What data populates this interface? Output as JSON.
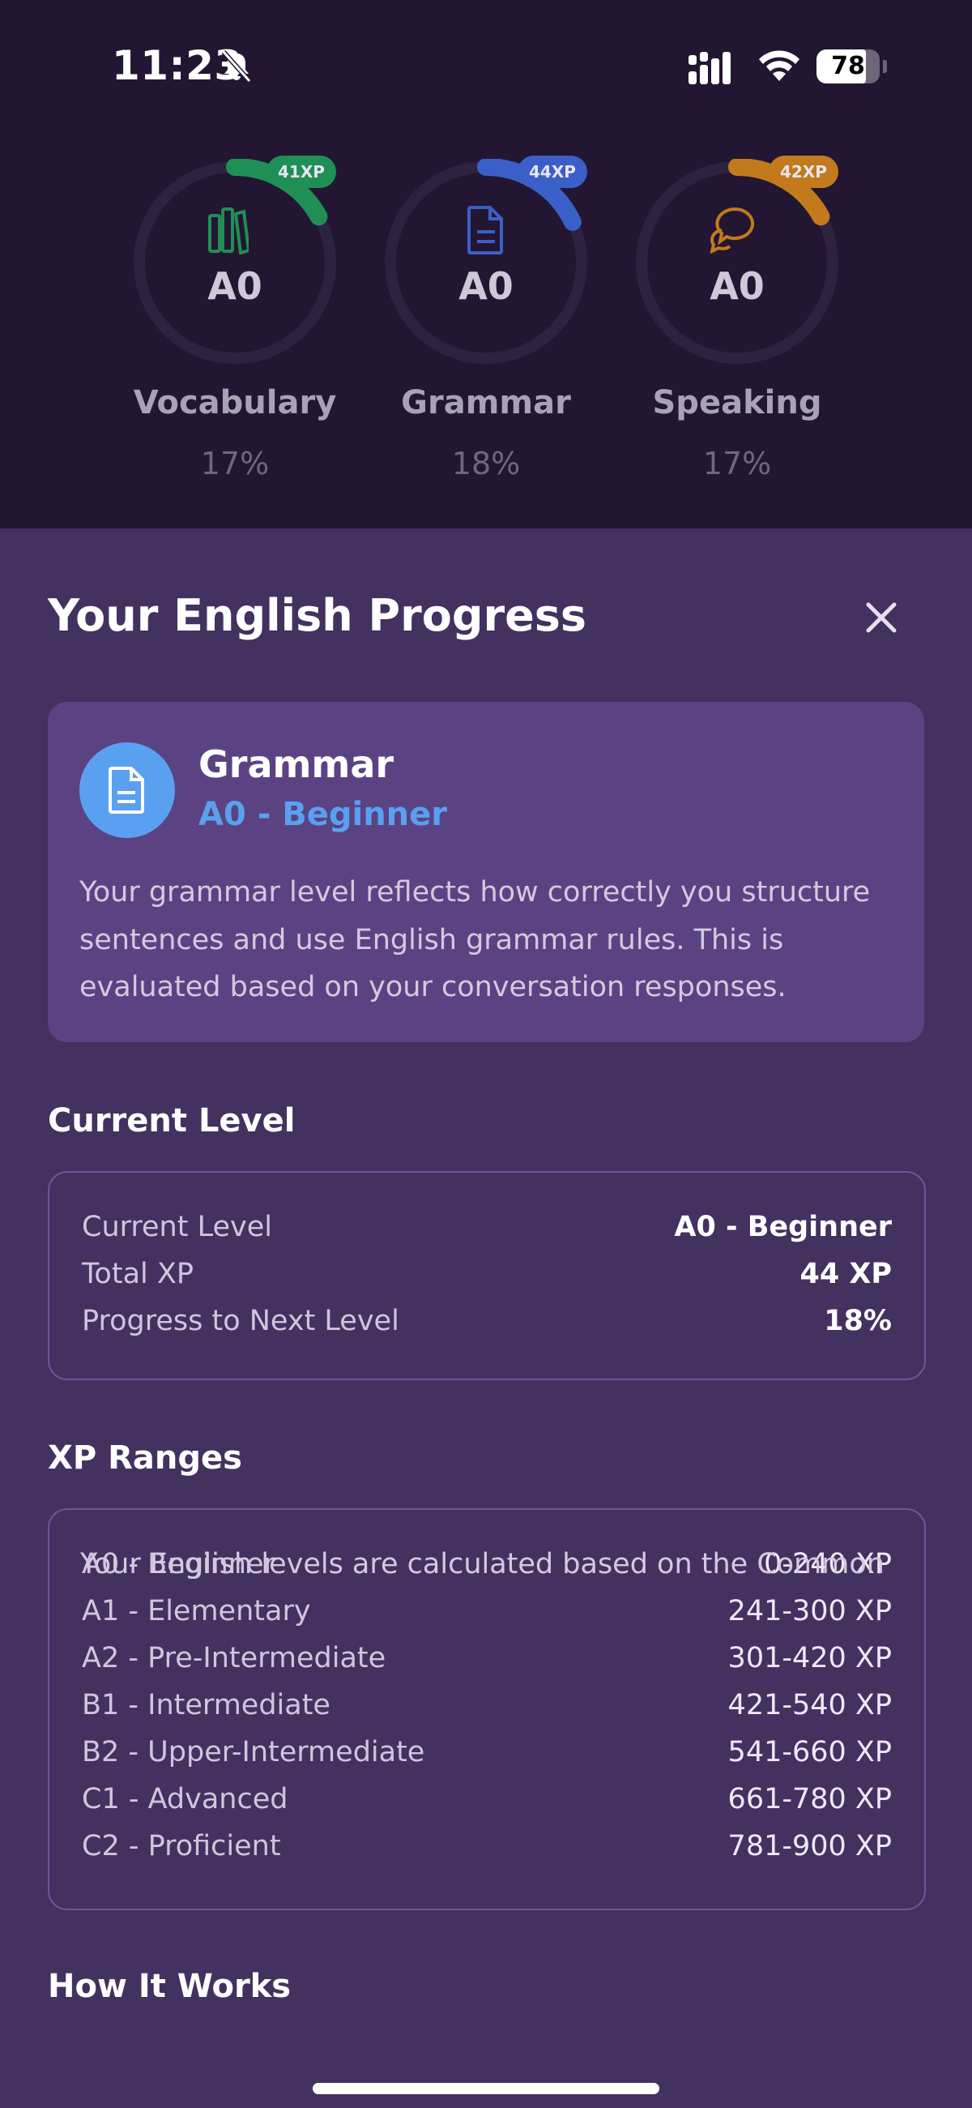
{
  "status_bar": {
    "time": "11:23",
    "battery": "78",
    "battery_level": 0.78
  },
  "skills": [
    {
      "name": "Vocabulary",
      "level": "A0",
      "percent": "17%",
      "progress": 0.17,
      "xp": "41XP",
      "color": "#1f8f55",
      "icon": "books-icon"
    },
    {
      "name": "Grammar",
      "level": "A0",
      "percent": "18%",
      "progress": 0.18,
      "xp": "44XP",
      "color": "#3b5fc8",
      "icon": "document-icon"
    },
    {
      "name": "Speaking",
      "level": "A0",
      "percent": "17%",
      "progress": 0.17,
      "xp": "42XP",
      "color": "#c27a1c",
      "icon": "chat-bubbles-icon"
    }
  ],
  "sheet": {
    "title": "Your English Progress",
    "info": {
      "title": "Grammar",
      "subtitle": "A0 - Beginner",
      "description": "Your grammar level reflects how correctly you structure sentences and use English grammar rules. This is evaluated based on your conversation responses."
    },
    "current_level": {
      "heading": "Current Level",
      "rows": [
        {
          "label": "Current Level",
          "value": "A0 - Beginner"
        },
        {
          "label": "Total XP",
          "value": "44 XP"
        },
        {
          "label": "Progress to Next Level",
          "value": "18%"
        }
      ]
    },
    "xp_ranges": {
      "heading": "XP Ranges",
      "rows": [
        {
          "label": "A0 - Beginner",
          "value": "0-240 XP"
        },
        {
          "label": "A1 - Elementary",
          "value": "241-300 XP"
        },
        {
          "label": "A2 - Pre-Intermediate",
          "value": "301-420 XP"
        },
        {
          "label": "B1 - Intermediate",
          "value": "421-540 XP"
        },
        {
          "label": "B2 - Upper-Intermediate",
          "value": "541-660 XP"
        },
        {
          "label": "C1 - Advanced",
          "value": "661-780 XP"
        },
        {
          "label": "C2 - Proficient",
          "value": "781-900 XP"
        }
      ]
    },
    "how_it_works": {
      "heading": "How It Works",
      "text": "Your English levels are calculated based on the Common"
    }
  },
  "colors": {
    "background": "#221632",
    "sheet": "#433160",
    "card": "#5b4383",
    "accent": "#5aa0f0"
  }
}
